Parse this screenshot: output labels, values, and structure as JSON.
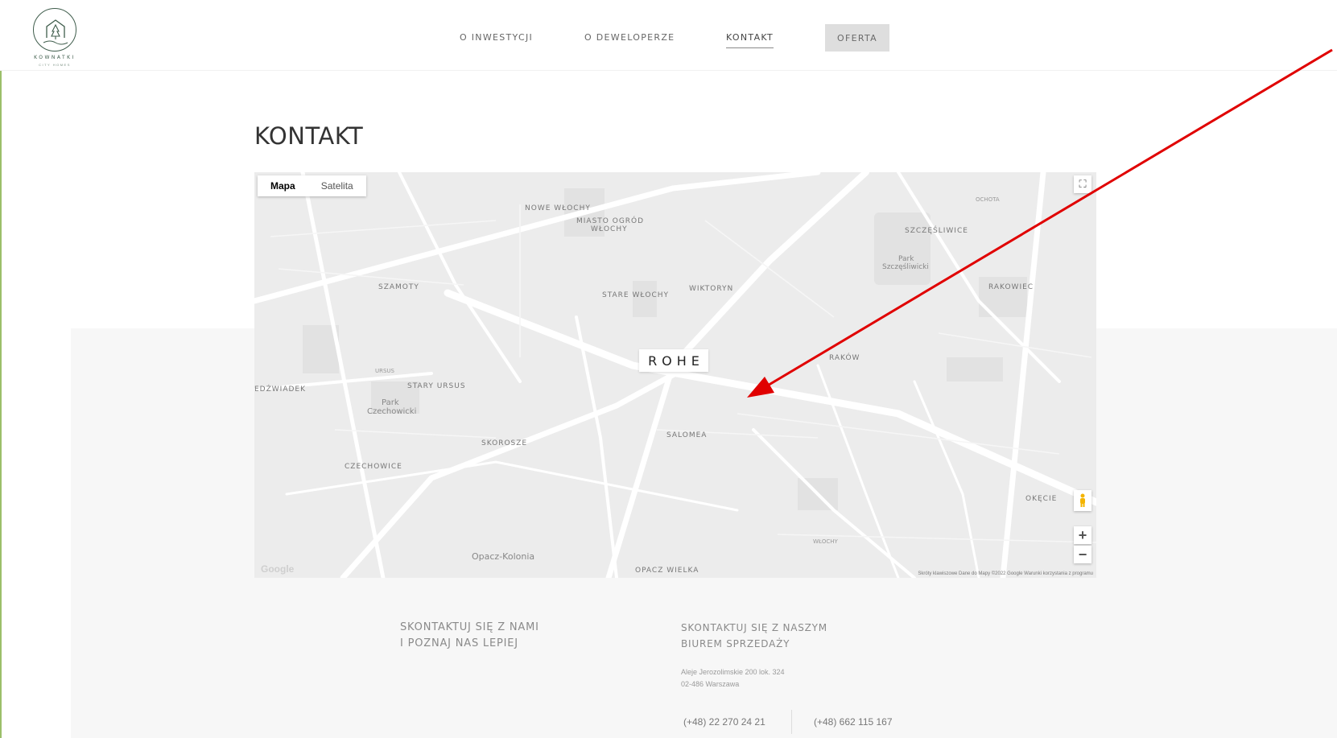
{
  "logo": {
    "name": "KOWNATKI",
    "sub": "CITY HOMES"
  },
  "nav": {
    "items": [
      "O INWESTYCJI",
      "O DEWELOPERZE",
      "KONTAKT"
    ],
    "active": "KONTAKT",
    "cta": "OFERTA"
  },
  "page": {
    "title": "KONTAKT"
  },
  "map": {
    "type_buttons": [
      "Mapa",
      "Satelita"
    ],
    "selected_type": "Mapa",
    "marker": "ROHE",
    "labels": {
      "nowe_wlochy": "NOWE WŁOCHY",
      "miasto_ogrod": "MIASTO OGRÓD",
      "wlochy_top": "WŁOCHY",
      "ochota": "OCHOTA",
      "szczesliwice": "SZCZĘŚLIWICE",
      "park_szczesliwicki_1": "Park",
      "park_szczesliwicki_2": "Szczęśliwicki",
      "szamoty": "SZAMOTY",
      "stare_wlochy": "STARE WŁOCHY",
      "wiktoryn": "WIKTORYN",
      "rakowiec": "RAKOWIEC",
      "ursus": "URSUS",
      "rakow": "RAKÓW",
      "edzwiadek": "EDŹWIADEK",
      "stary_ursus": "STARY URSUS",
      "park_czechowicki_1": "Park",
      "park_czechowicki_2": "Czechowicki",
      "salomea": "SALOMEA",
      "skorosze": "SKOROSZE",
      "czechowice": "CZECHOWICE",
      "okecie": "OKĘCIE",
      "wlochy_bottom": "WŁOCHY",
      "opacz_kolonia": "Opacz-Kolonia",
      "opacz_wielka": "OPACZ WIELKA"
    },
    "attribution": "Skróty klawiszowe   Dane do Mapy ©2022 Google   Warunki korzystania z programu",
    "google": "Google"
  },
  "contact": {
    "left_line1": "SKONTAKTUJ SIĘ Z NAMI",
    "left_line2": "I POZNAJ NAS LEPIEJ",
    "right_line1": "SKONTAKTUJ SIĘ Z NASZYM",
    "right_line2": "BIUREM SPRZEDAŻY",
    "address_line1": "Aleje Jerozolimskie 200 lok. 324",
    "address_line2": "02-486 Warszawa",
    "phone1": "(+48) 22 270 24 21",
    "phone2": "(+48) 662 115 167"
  },
  "colors": {
    "annotation_arrow": "#e00000",
    "logo": "#3f5d4c",
    "cta_bg": "#dedede"
  }
}
